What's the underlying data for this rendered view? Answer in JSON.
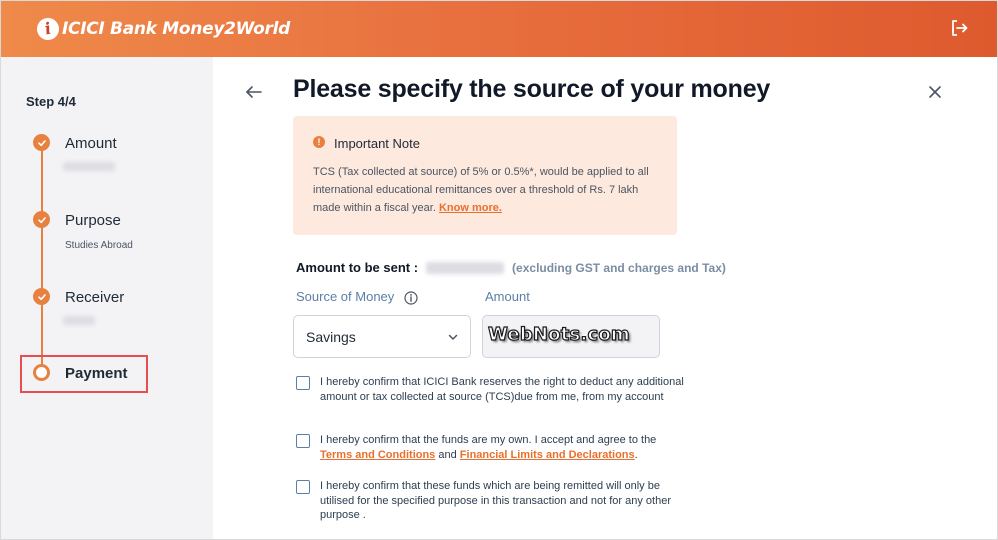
{
  "header": {
    "logo_mark": "i",
    "logo_text": "ICICI Bank Money2World"
  },
  "sidebar": {
    "step_count": "Step 4/4",
    "steps": [
      {
        "label": "Amount",
        "sub": ""
      },
      {
        "label": "Purpose",
        "sub": "Studies Abroad"
      },
      {
        "label": "Receiver",
        "sub": ""
      },
      {
        "label": "Payment",
        "sub": ""
      }
    ]
  },
  "main": {
    "title": "Please specify the source of your money",
    "note": {
      "icon": "!",
      "title": "Important Note",
      "body": "TCS (Tax collected at source) of 5% or 0.5%*, would be applied to all international educational remittances over a threshold of Rs. 7 lakh made within a fiscal year.",
      "link": "Know more."
    },
    "amount_label": "Amount to be sent :",
    "amount_note": "(excluding GST and charges and Tax)",
    "source_label": "Source of Money",
    "amount_field_label": "Amount",
    "source_value": "Savings",
    "watermark": "WebNots.com",
    "confirmations": [
      {
        "text": "I hereby confirm that ICICI Bank reserves the right to deduct any additional amount or tax collected at source (TCS)due from me, from my account"
      },
      {
        "text_before": "I hereby confirm that the funds are my own. I accept and agree to the",
        "link1": "Terms and Conditions",
        "and": "and",
        "link2": "Financial Limits and Declarations",
        "end": "."
      },
      {
        "text": "I hereby confirm that these funds which are being remitted will only be utilised for the specified purpose in this transaction and not for any other purpose ."
      }
    ]
  },
  "colors": {
    "accent": "#e8813f",
    "highlight": "#e94e4e",
    "label_blue": "#5b7fa6"
  }
}
